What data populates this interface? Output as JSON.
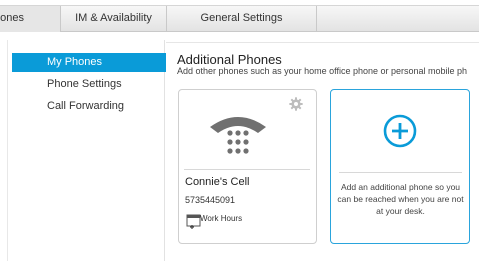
{
  "tabs": [
    {
      "label": "hones",
      "active": true
    },
    {
      "label": "IM & Availability",
      "active": false
    },
    {
      "label": "General Settings",
      "active": false
    }
  ],
  "sidebar": {
    "items": [
      {
        "label": "My Phones",
        "selected": true
      },
      {
        "label": "Phone Settings",
        "selected": false
      },
      {
        "label": "Call Forwarding",
        "selected": false
      }
    ]
  },
  "main": {
    "title": "Additional Phones",
    "subtitle": "Add other phones such as your home office phone or personal mobile ph"
  },
  "phone_card": {
    "name": "Connie's Cell",
    "number": "5735445091",
    "schedule_label": "Work Hours",
    "icons": [
      "gear-icon",
      "desk-phone-icon",
      "calendar-add-icon"
    ]
  },
  "add_card": {
    "text": "Add an additional phone so you can be reached when you are not at your desk.",
    "icon": "plus-circle-icon"
  },
  "colors": {
    "accent": "#0a9bd8",
    "add_card_border": "#2aa4dc",
    "phone_icon": "#707070"
  }
}
